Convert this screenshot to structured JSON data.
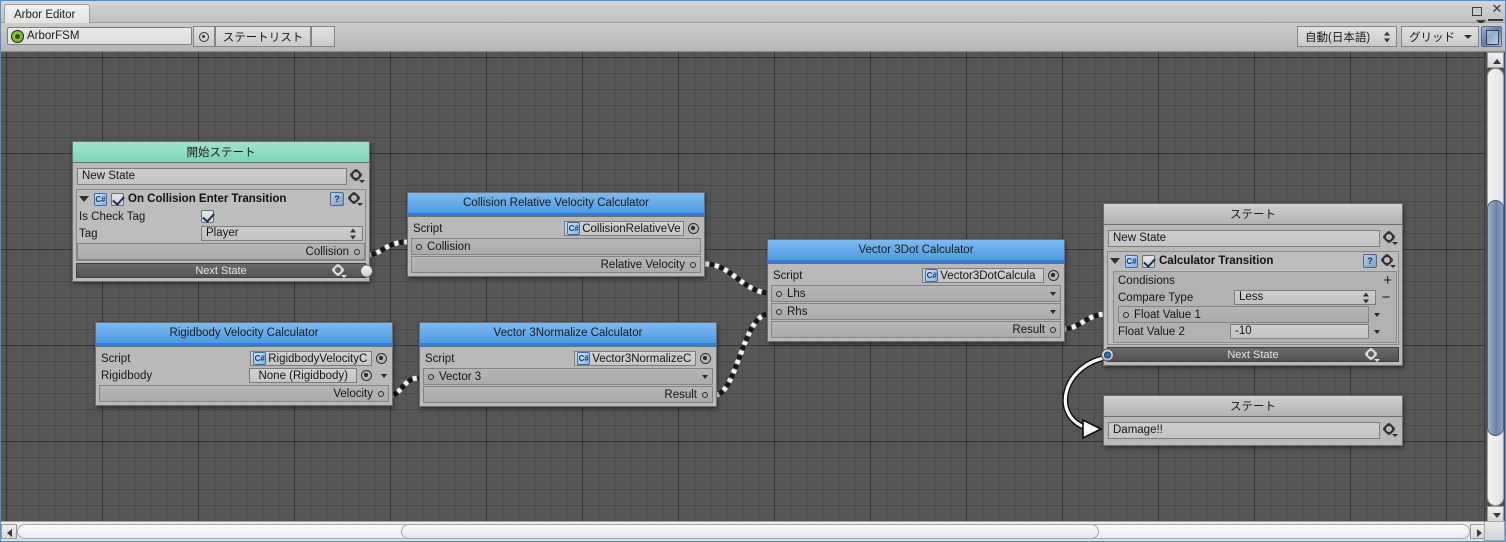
{
  "window": {
    "tab_title": "Arbor Editor",
    "maximize_icon": "maximize-icon",
    "close_icon": "close-icon",
    "menu_icon": "hamburger-menu-icon"
  },
  "toolbar": {
    "fsm_field_value": "ArborFSM",
    "fsm_icon": "unity-object-icon",
    "pick_icon": "object-picker-icon",
    "state_list_label": "ステートリスト",
    "blank_label": "",
    "language_value": "自動(日本語)",
    "grid_value": "グリッド",
    "book_icon": "documentation-icon"
  },
  "nodes": {
    "start_state": {
      "header": "開始ステート",
      "name_value": "New State",
      "gear_icon": "gear-icon",
      "behaviour": {
        "foldout_icon": "foldout-open-icon",
        "script_icon": "csharp-script-icon",
        "enabled": true,
        "title": "On Collision Enter Transition",
        "help_icon": "help-icon",
        "gear_icon": "gear-icon",
        "rows": [
          {
            "label": "Is Check Tag",
            "type": "checkbox",
            "value": true
          },
          {
            "label": "Tag",
            "type": "popup",
            "value": "Player"
          }
        ],
        "output_slot": "Collision"
      },
      "next_state_label": "Next State"
    },
    "collision_relative_velocity": {
      "header": "Collision Relative Velocity Calculator",
      "script_label": "Script",
      "script_value": "CollisionRelativeVe",
      "script_icon": "csharp-script-icon",
      "picker_icon": "object-picker-icon",
      "input_slot": "Collision",
      "output_slot": "Relative Velocity"
    },
    "vector3_dot": {
      "header": "Vector 3Dot Calculator",
      "script_label": "Script",
      "script_value": "Vector3DotCalcula",
      "script_icon": "csharp-script-icon",
      "picker_icon": "object-picker-icon",
      "input_slots": [
        "Lhs",
        "Rhs"
      ],
      "output_slot": "Result"
    },
    "rigidbody_velocity": {
      "header": "Rigidbody Velocity Calculator",
      "script_label": "Script",
      "script_value": "RigidbodyVelocityC",
      "script_icon": "csharp-script-icon",
      "picker_icon": "object-picker-icon",
      "rigidbody_label": "Rigidbody",
      "rigidbody_value": "None (Rigidbody)",
      "output_slot": "Velocity"
    },
    "vector3_normalize": {
      "header": "Vector 3Normalize Calculator",
      "script_label": "Script",
      "script_value": "Vector3NormalizeC",
      "script_icon": "csharp-script-icon",
      "picker_icon": "object-picker-icon",
      "input_slot": "Vector 3",
      "output_slot": "Result"
    },
    "calculator_state": {
      "header": "ステート",
      "name_value": "New State",
      "gear_icon": "gear-icon",
      "behaviour": {
        "foldout_icon": "foldout-open-icon",
        "script_icon": "csharp-script-icon",
        "enabled": true,
        "title": "Calculator Transition",
        "help_icon": "help-icon",
        "gear_icon": "gear-icon",
        "conditions_label": "Condisions",
        "add_label": "+",
        "remove_label": "−",
        "compare_type_label": "Compare Type",
        "compare_type_value": "Less",
        "float1_label": "Float Value 1",
        "float2_label": "Float Value 2",
        "float2_value": "-10"
      },
      "next_state_label": "Next State"
    },
    "damage_state": {
      "header": "ステート",
      "name_value": "Damage!!",
      "gear_icon": "gear-icon"
    }
  },
  "scrollbars": {
    "v_up_icon": "scroll-up-arrow",
    "v_down_icon": "scroll-down-arrow",
    "h_left_icon": "scroll-left-arrow",
    "h_right_icon": "scroll-right-arrow"
  },
  "colors": {
    "canvas_bg": "#565656",
    "start_header": "#8ddbc1",
    "calc_header": "#62a8e8",
    "state_header": "#c0c0c0",
    "accent_blue": "#2f7fd4"
  }
}
